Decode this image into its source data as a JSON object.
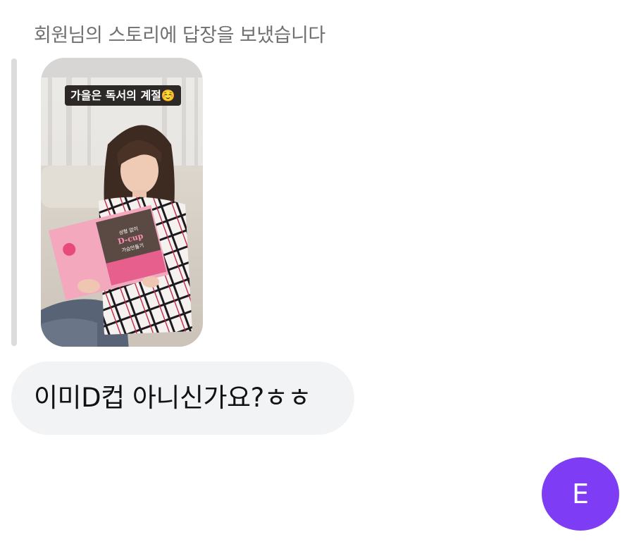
{
  "reply_header": "회원님의 스토리에 답장을 보냈습니다",
  "story": {
    "caption": "가을은 독서의 계절☺️",
    "book_cover_text": [
      "성형 없이",
      "D-cup",
      "가슴만들기"
    ]
  },
  "message": {
    "text": "이미D컵 아니신가요?ㅎㅎ"
  },
  "avatar": {
    "initial": "E",
    "color": "#7e3df5"
  }
}
